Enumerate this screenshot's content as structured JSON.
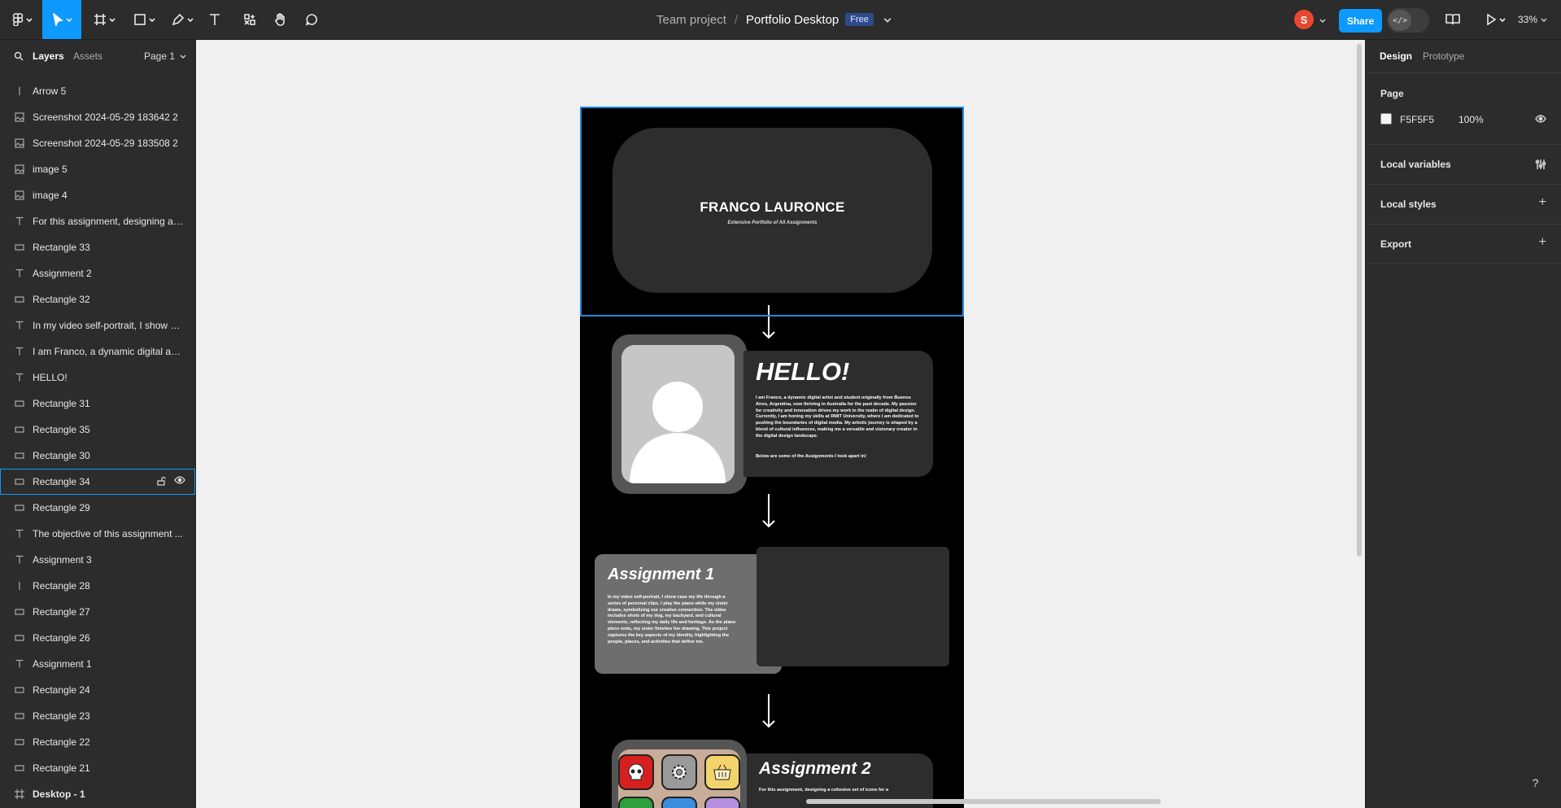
{
  "toolbar": {
    "breadcrumb_team": "Team project",
    "breadcrumb_sep": "/",
    "file_name": "Portfolio Desktop",
    "plan_badge": "Free",
    "avatar_initial": "S",
    "share_label": "Share",
    "zoom": "33%",
    "accent_color": "#0d99ff"
  },
  "left_panel": {
    "tab_layers": "Layers",
    "tab_assets": "Assets",
    "page_select": "Page 1",
    "layers": [
      {
        "name": "Arrow 5",
        "icon": "line-icon"
      },
      {
        "name": "Screenshot 2024-05-29 183642 2",
        "icon": "image-icon"
      },
      {
        "name": "Screenshot 2024-05-29 183508 2",
        "icon": "image-icon"
      },
      {
        "name": "image 5",
        "icon": "image-icon"
      },
      {
        "name": "image 4",
        "icon": "image-icon"
      },
      {
        "name": "For this assignment, designing a c...",
        "icon": "text-icon"
      },
      {
        "name": "Rectangle 33",
        "icon": "rect-icon"
      },
      {
        "name": "Assignment 2",
        "icon": "text-icon"
      },
      {
        "name": "Rectangle 32",
        "icon": "rect-icon"
      },
      {
        "name": "In my video self-portrait, I show c...",
        "icon": "text-icon"
      },
      {
        "name": "I am Franco, a dynamic digital arti...",
        "icon": "text-icon"
      },
      {
        "name": "HELLO!",
        "icon": "text-icon"
      },
      {
        "name": "Rectangle 31",
        "icon": "rect-icon"
      },
      {
        "name": "Rectangle 35",
        "icon": "rect-icon"
      },
      {
        "name": "Rectangle 30",
        "icon": "rect-icon"
      },
      {
        "name": "Rectangle 34",
        "icon": "rect-icon"
      },
      {
        "name": "Rectangle 29",
        "icon": "rect-icon"
      },
      {
        "name": "The objective of this assignment ...",
        "icon": "text-icon"
      },
      {
        "name": "Assignment 3",
        "icon": "text-icon"
      },
      {
        "name": "Rectangle 28",
        "icon": "line-icon"
      },
      {
        "name": "Rectangle 27",
        "icon": "rect-icon"
      },
      {
        "name": "Rectangle 26",
        "icon": "rect-icon"
      },
      {
        "name": "Assignment 1",
        "icon": "text-icon"
      },
      {
        "name": "Rectangle 24",
        "icon": "rect-icon"
      },
      {
        "name": "Rectangle 23",
        "icon": "rect-icon"
      },
      {
        "name": "Rectangle 22",
        "icon": "rect-icon"
      },
      {
        "name": "Rectangle 21",
        "icon": "rect-icon"
      },
      {
        "name": "Desktop - 1",
        "icon": "frame-icon"
      }
    ],
    "selected_layer": "Rectangle 34"
  },
  "right_panel": {
    "tab_design": "Design",
    "tab_prototype": "Prototype",
    "page_section": "Page",
    "page_color": "F5F5F5",
    "page_opacity": "100%",
    "local_variables": "Local variables",
    "local_styles": "Local styles",
    "export": "Export"
  },
  "canvas": {
    "hero_name": "FRANCO LAURONCE",
    "hero_subtitle": "Extensive Portfolio of All Assignments",
    "hello_title": "HELLO!",
    "hello_body": "I am Franco, a dynamic digital artist and student originally from Buenos Aires, Argentina, now thriving in Australia for the past decade. My passion for creativity and innovation drives my work in the realm of digital design. Currently, I am honing my skills at RMIT University, where I am dedicated to pushing the boundaries of digital media. My artistic journey is shaped by a blend of cultural influences, making me a versatile and visionary creator in the digital design landscape.",
    "hello_note": "Below are some of the Assignments I took apart in!",
    "a1_title": "Assignment 1",
    "a1_body": "In my video self-portrait, I show case my life through a series of personal clips. I play the piano while my sister draws, symbolizing our creative connection. The video includes shots of my dog, my backyard, and cultural elements, reflecting my daily life and heritage. As the piano piece ends, my sister finishes her drawing. This project captures the key aspects of my identity, highlighting the people, places, and activities that define me.",
    "a2_title": "Assignment 2",
    "a2_body": "For this assignment, designing a cohesive set of icons for a"
  },
  "help_label": "?"
}
